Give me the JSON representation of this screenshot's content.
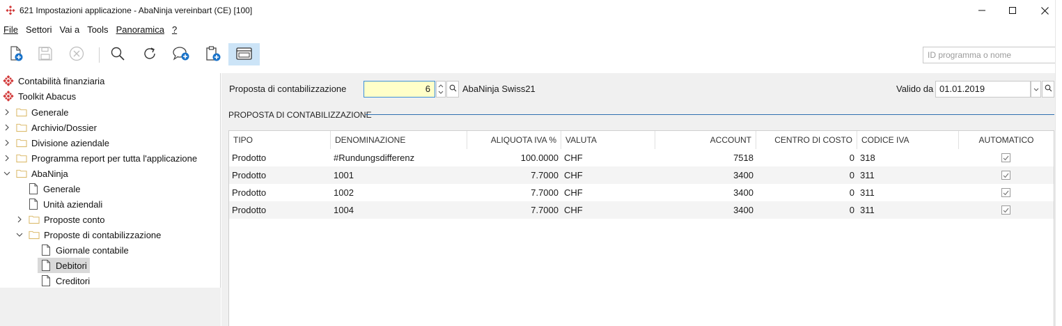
{
  "window": {
    "title": "621 Impostazioni applicazione - AbaNinja vereinbart (CE) [100]"
  },
  "menu": {
    "items": [
      {
        "label": "File",
        "underline": true
      },
      {
        "label": "Settori",
        "underline": false
      },
      {
        "label": "Vai a",
        "underline": false
      },
      {
        "label": "Tools",
        "underline": false
      },
      {
        "label": "Panoramica",
        "underline": true
      },
      {
        "label": "?",
        "underline": true
      }
    ]
  },
  "toolbar": {
    "search_placeholder": "ID programma o nome",
    "buttons": [
      "new-document-icon",
      "save-icon",
      "cancel-icon",
      "search-icon",
      "refresh-icon",
      "comment-add-icon",
      "clipboard-add-icon",
      "window-icon"
    ]
  },
  "tree": {
    "items": [
      {
        "label": "Contabilità finanziaria",
        "icon": "abacus-icon",
        "level": 0,
        "chevron": "none"
      },
      {
        "label": "Toolkit Abacus",
        "icon": "abacus-icon",
        "level": 0,
        "chevron": "none"
      },
      {
        "label": "Generale",
        "icon": "folder-icon",
        "level": 0,
        "chevron": "right"
      },
      {
        "label": "Archivio/Dossier",
        "icon": "folder-icon",
        "level": 0,
        "chevron": "right"
      },
      {
        "label": "Divisione aziendale",
        "icon": "folder-icon",
        "level": 0,
        "chevron": "right"
      },
      {
        "label": "Programma report per tutta l'applicazione",
        "icon": "folder-icon",
        "level": 0,
        "chevron": "right"
      },
      {
        "label": "AbaNinja",
        "icon": "folder-icon",
        "level": 0,
        "chevron": "down"
      },
      {
        "label": "Generale",
        "icon": "page-icon",
        "level": 1,
        "chevron": "none"
      },
      {
        "label": "Unità aziendali",
        "icon": "page-icon",
        "level": 1,
        "chevron": "none"
      },
      {
        "label": "Proposte conto",
        "icon": "folder-icon",
        "level": 1,
        "chevron": "right"
      },
      {
        "label": "Proposte di contabilizzazione",
        "icon": "folder-icon",
        "level": 1,
        "chevron": "down"
      },
      {
        "label": "Giornale contabile",
        "icon": "page-icon",
        "level": 2,
        "chevron": "none"
      },
      {
        "label": "Debitori",
        "icon": "page-icon",
        "level": 2,
        "chevron": "none",
        "selected": true
      },
      {
        "label": "Creditori",
        "icon": "page-icon",
        "level": 2,
        "chevron": "none"
      }
    ]
  },
  "form": {
    "proposta_label": "Proposta di contabilizzazione",
    "proposta_value": "6",
    "proposta_name": "AbaNinja Swiss21",
    "valido_label": "Valido da",
    "valido_value": "01.01.2019",
    "section_title": "PROPOSTA DI CONTABILIZZAZIONE"
  },
  "grid": {
    "columns": [
      "TIPO",
      "DENOMINAZIONE",
      "ALIQUOTA IVA %",
      "VALUTA",
      "ACCOUNT",
      "CENTRO DI COSTO",
      "CODICE IVA",
      "AUTOMATICO"
    ],
    "rows": [
      {
        "tipo": "Prodotto",
        "denominazione": "#Rundungsdifferenz",
        "aliquota": "100.0000",
        "valuta": "CHF",
        "account": "7518",
        "centro": "0",
        "codice": "318",
        "automatico": true
      },
      {
        "tipo": "Prodotto",
        "denominazione": "1001",
        "aliquota": "7.7000",
        "valuta": "CHF",
        "account": "3400",
        "centro": "0",
        "codice": "311",
        "automatico": true
      },
      {
        "tipo": "Prodotto",
        "denominazione": "1002",
        "aliquota": "7.7000",
        "valuta": "CHF",
        "account": "3400",
        "centro": "0",
        "codice": "311",
        "automatico": true
      },
      {
        "tipo": "Prodotto",
        "denominazione": "1004",
        "aliquota": "7.7000",
        "valuta": "CHF",
        "account": "3400",
        "centro": "0",
        "codice": "311",
        "automatico": true
      }
    ]
  },
  "colors": {
    "accent": "#2f6fb0",
    "input_highlight": "#ffffc9",
    "toolbar_active": "#cce4f7"
  }
}
